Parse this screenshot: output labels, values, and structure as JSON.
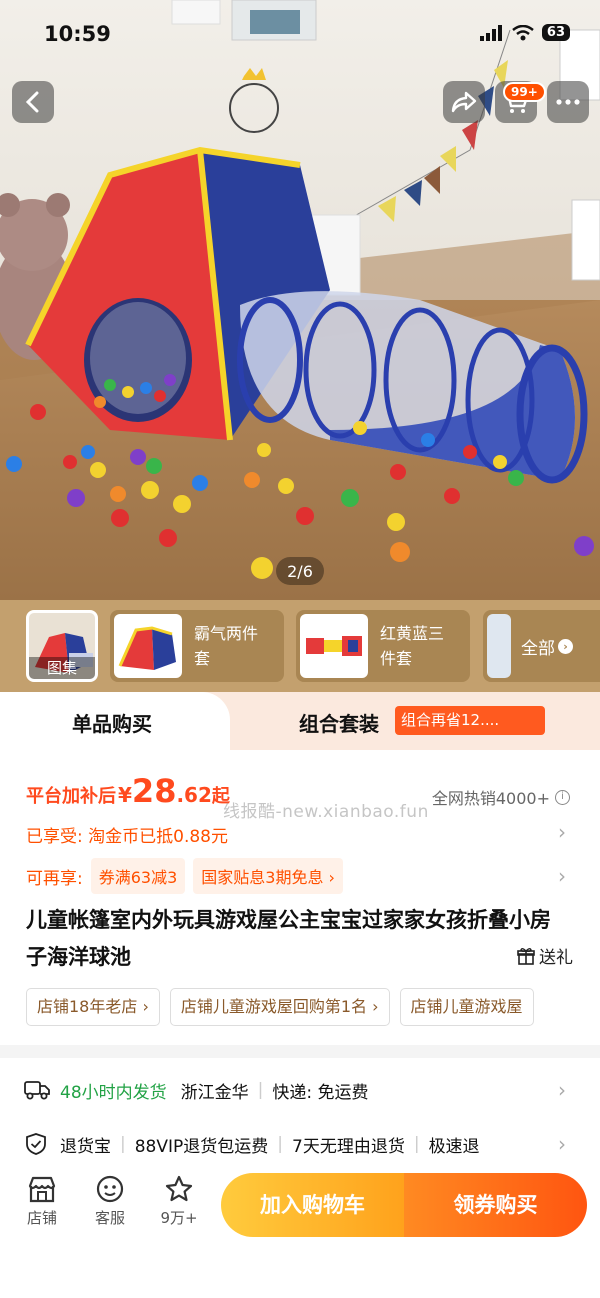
{
  "status_bar": {
    "time": "10:59",
    "battery": "63"
  },
  "header": {
    "cart_badge": "99+"
  },
  "gallery": {
    "counter": "2/6",
    "gallery_label": "图集"
  },
  "sku_options": [
    {
      "name": "霸气两件套"
    },
    {
      "name": "红黄蓝三件套"
    }
  ],
  "sku_all_label": "全部",
  "tabs": {
    "single": "单品购买",
    "bundle": "组合套装",
    "bundle_badge": "组合再省12...."
  },
  "price": {
    "label": "平台加补后",
    "currency": "¥",
    "integer": "28",
    "decimal": ".62",
    "suffix": "起",
    "hot_sales": "全网热销4000+"
  },
  "watermark": "线报酷-new.xianbao.fun",
  "enjoyed": "已享受: 淘金币已抵0.88元",
  "more_offers": {
    "label": "可再享:",
    "tags": [
      "券满63减3",
      "国家贴息3期免息 ›"
    ]
  },
  "product_title": "儿童帐篷室内外玩具游戏屋公主宝宝过家家女孩折叠小房子海洋球池",
  "gift_label": "送礼",
  "shop_tags": [
    "店铺18年老店 ›",
    "店铺儿童游戏屋回购第1名 ›",
    "店铺儿童游戏屋"
  ],
  "delivery": {
    "ship_time": "48小时内发货",
    "origin": "浙江金华",
    "express": "快递: 免运费",
    "services": [
      "退货宝",
      "88VIP退货包运费",
      "7天无理由退货",
      "极速退"
    ]
  },
  "bottom_nav": {
    "shop": "店铺",
    "service": "客服",
    "favorites": "9万+"
  },
  "buttons": {
    "add_cart": "加入购物车",
    "buy": "领券购买"
  },
  "colors": {
    "accent": "#ff5000",
    "green": "#22a245",
    "sku_bg": "#c3a06e"
  }
}
